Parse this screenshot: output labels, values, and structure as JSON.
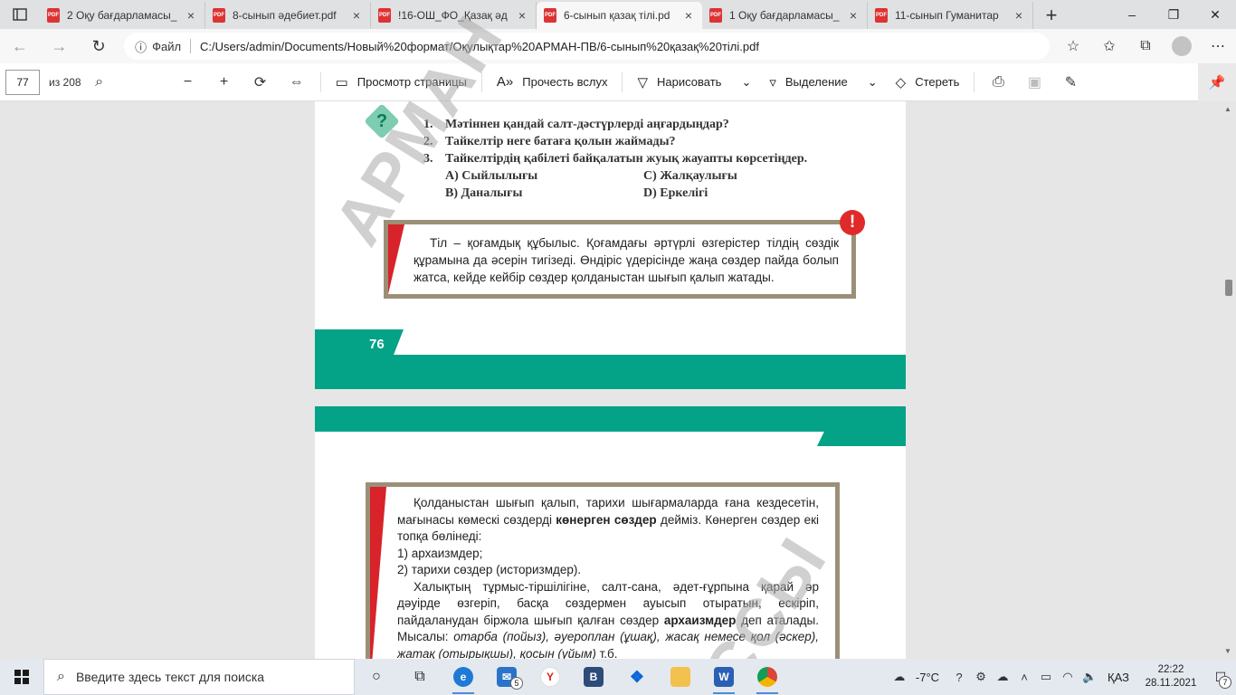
{
  "browser": {
    "tabs": [
      {
        "label": "2 Оқу бағдарламасы_",
        "active": false
      },
      {
        "label": "8-сынып әдебиет.pdf",
        "active": false
      },
      {
        "label": "!16-ОШ_ФО_Қазақ әд",
        "active": false
      },
      {
        "label": "6-сынып қазақ тілі.pd",
        "active": true
      },
      {
        "label": "1 Оқу бағдарламасы_",
        "active": false
      },
      {
        "label": "11-сынып Гуманитар",
        "active": false
      }
    ],
    "address": {
      "file_label": "Файл",
      "url": "C:/Users/admin/Documents/Новый%20формат/Оқулықтар%20АРМАН-ПВ/6-сынып%20қазақ%20тілі.pdf"
    }
  },
  "pdf_toolbar": {
    "page_current": "77",
    "page_total": "из 208",
    "page_view": "Просмотр страницы",
    "read_aloud": "Прочесть вслух",
    "draw": "Нарисовать",
    "highlight": "Выделение",
    "erase": "Стереть"
  },
  "page1": {
    "questions": [
      {
        "num": "1.",
        "text": "Мәтіннен қандай салт-дәстүрлерді аңғардыңдар?"
      },
      {
        "num": "2.",
        "text": "Тайкелтір неге батаға қолын жаймады?"
      },
      {
        "num": "3.",
        "text": "Тайкелтірдің қабілеті байқалатын жуық жауапты көрсетіңдер."
      }
    ],
    "options": {
      "a": "А) Сыйлылығы",
      "c": "С) Жалқаулығы",
      "b": "В) Даналығы",
      "d": "D) Еркелігі"
    },
    "note": "Тіл – қоғамдық құбылыс. Қоғамдағы әртүрлі өзгерістер тілдің сөздік құрамына да әсерін тигізеді. Өндіріс үдерісінде жаңа сөздер пайда болып жатса, кейде кейбір сөздер қолданыстан шығып қалып жатады.",
    "page_number": "76"
  },
  "page2": {
    "def_intro": "Қолданыстан шығып қалып, тарихи шығармаларда ғана кездесетін, мағынасы көмескі сөздерді ",
    "def_term": "көнерген сөздер",
    "def_rest": " дейміз. Көнерген сөздер екі топқа бөлінеді:",
    "list": [
      "1) архаизмдер;",
      "2) тарихи сөздер (историзмдер)."
    ],
    "arch_intro": "Халықтың тұрмыс-тіршілігіне, салт-сана, әдет-ғұрпына қарай әр дәуірде өзгеріп, басқа сөздермен ауысып отыратын, ескіріп, пайдаланудан біржола шығып қалған сөздер ",
    "arch_term": "архаизмдер",
    "arch_rest": " деп аталады.",
    "examples_label": "Мысалы: ",
    "examples": "отарба (пойыз), әуероплан (ұшақ), жасақ немесе қол (әскер), жатақ (отырықшы), қосын (үйым)",
    "examples_end": " т.б."
  },
  "watermark": {
    "top": "АРМАН",
    "bottom": "ССЫ"
  },
  "taskbar": {
    "search_placeholder": "Введите здесь текст для поиска",
    "mail_badge": "5",
    "temperature": "-7°C",
    "language": "ҚАЗ",
    "time": "22:22",
    "date": "28.11.2021",
    "notifications": "7"
  }
}
